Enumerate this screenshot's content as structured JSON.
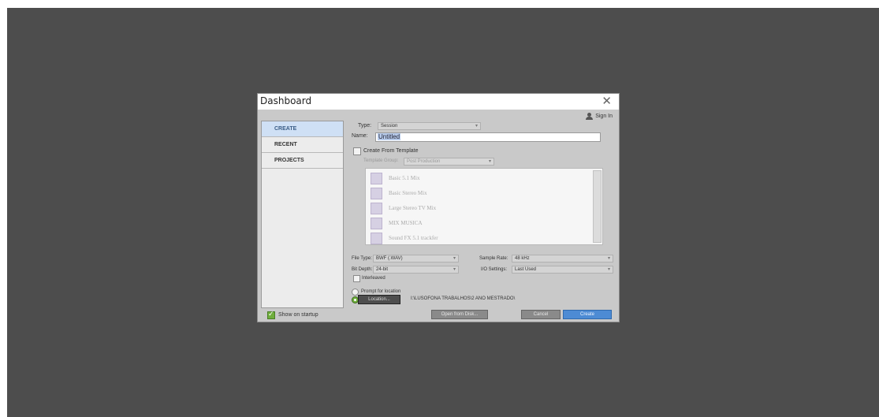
{
  "dialog": {
    "title": "Dashboard",
    "close_glyph": "✕",
    "sign_in": "Sign In"
  },
  "sidebar": {
    "items": [
      {
        "label": "CREATE",
        "active": true
      },
      {
        "label": "RECENT",
        "active": false
      },
      {
        "label": "PROJECTS",
        "active": false
      }
    ]
  },
  "create": {
    "type_label": "Type:",
    "type_value": "Session",
    "name_label": "Name:",
    "name_value": "Untitled",
    "from_template_label": "Create From Template",
    "from_template_checked": false,
    "template_group_label": "Template Group:",
    "template_group_value": "Post Production",
    "templates": [
      "Basic 5.1 Mix",
      "Basic Stereo Mix",
      "Large Stereo TV Mix",
      "MIX MUSICA",
      "Sound FX 5.1 trackfer"
    ],
    "file_type_label": "File Type:",
    "file_type_value": "BWF (.WAV)",
    "sample_rate_label": "Sample Rate:",
    "sample_rate_value": "48 kHz",
    "bit_depth_label": "Bit Depth:",
    "bit_depth_value": "24-bit",
    "io_settings_label": "I/O Settings:",
    "io_settings_value": "Last Used",
    "interleaved_label": "Interleaved",
    "interleaved_checked": false,
    "prompt_location_label": "Prompt for location",
    "location_button": "Location...",
    "location_path": "I:\\LUSOFONA TRABALHOS\\2 ANO MESTRADO\\"
  },
  "footer": {
    "show_on_startup": "Show on startup",
    "show_on_startup_checked": true,
    "open_from_disk": "Open from Disk...",
    "cancel": "Cancel",
    "create": "Create"
  },
  "icons": {
    "user": "user-icon",
    "close": "close-icon",
    "template": "session-template-icon",
    "dropdown": "chevron-down-icon"
  },
  "colors": {
    "backdrop": "#4d4d4d",
    "dialog": "#c9c9c9",
    "active_tab": "#cfe0f5",
    "primary_button": "#4d8bd4",
    "checkbox_checked": "#6fae3c"
  }
}
